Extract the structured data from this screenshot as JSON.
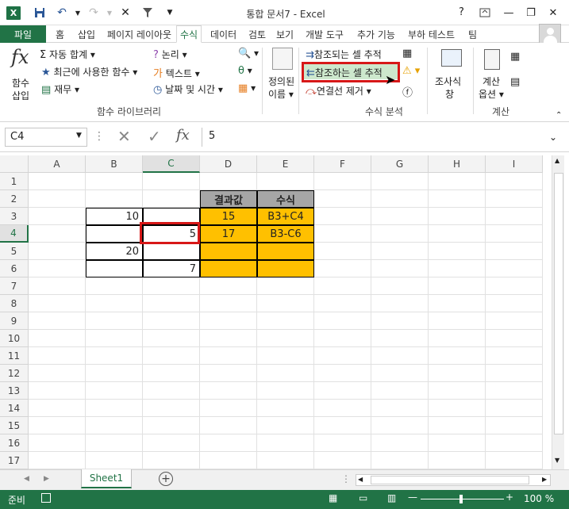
{
  "window": {
    "title": "통합 문서7 - Excel",
    "help": "?"
  },
  "tabs": [
    "파일",
    "홈",
    "삽입",
    "페이지 레이아웃",
    "수식",
    "데이터",
    "검토",
    "보기",
    "개발 도구",
    "추가 기능",
    "부하 테스트",
    "팀"
  ],
  "ribbon": {
    "insert_function": [
      "함수",
      "삽입"
    ],
    "autosum": "자동 합계",
    "recent": "최근에 사용한 함수",
    "financial": "재무",
    "logical": "논리",
    "text": "텍스트",
    "datetime": "날짜 및 시간",
    "group_function_library": "함수 라이브러리",
    "defined_names": [
      "정의된",
      "이름"
    ],
    "trace_precedents": "참조되는 셀 추적",
    "trace_dependents": "참조하는 셀 추적",
    "remove_arrows": "연결선 제거",
    "group_formula_auditing": "수식 분석",
    "watch_window": [
      "조사식",
      "창"
    ],
    "calc_options": [
      "계산",
      "옵션"
    ],
    "group_calculation": "계산"
  },
  "formula_bar": {
    "name_box": "C4",
    "value": "5"
  },
  "columns": [
    "A",
    "B",
    "C",
    "D",
    "E",
    "F",
    "G",
    "H",
    "I"
  ],
  "rows": [
    "1",
    "2",
    "3",
    "4",
    "5",
    "6",
    "7",
    "8",
    "9",
    "10",
    "11",
    "12",
    "13",
    "14",
    "15",
    "16",
    "17"
  ],
  "cells": {
    "B3": "10",
    "C4": "5",
    "B5": "20",
    "C6": "7",
    "D2": "결과값",
    "E2": "수식",
    "D3": "15",
    "E3": "B3+C4",
    "D4": "17",
    "E4": "B3-C6"
  },
  "sheets": {
    "active": "Sheet1"
  },
  "status": {
    "ready": "준비",
    "zoom": "100 %"
  },
  "colors": {
    "excel_green": "#217346",
    "orange": "#ffc000",
    "header_gray": "#a6a6a6",
    "highlight_red": "#d71818"
  }
}
